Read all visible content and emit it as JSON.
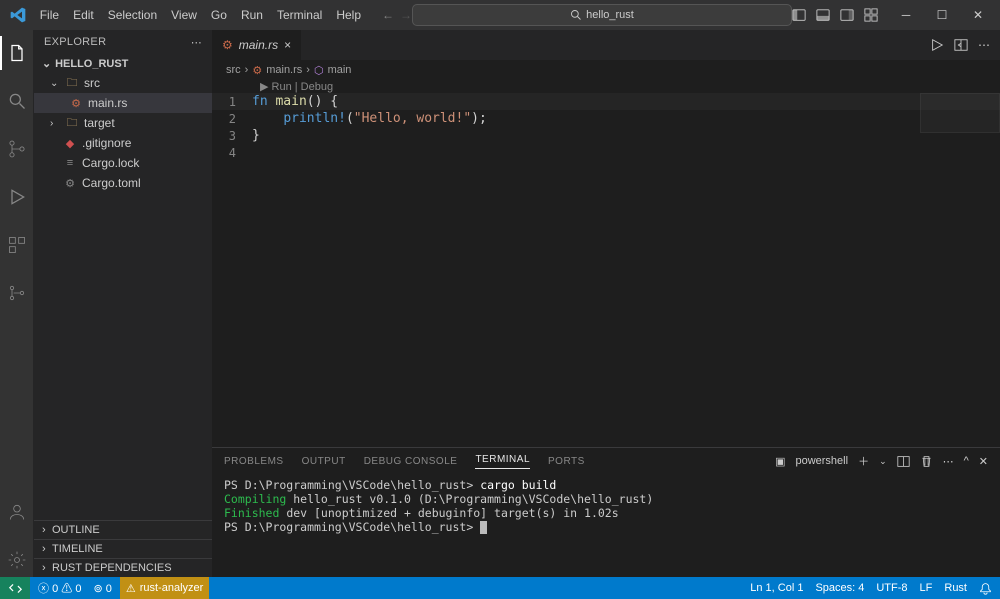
{
  "titlebar": {
    "menu": [
      "File",
      "Edit",
      "Selection",
      "View",
      "Go",
      "Run",
      "Terminal",
      "Help"
    ],
    "search": "hello_rust"
  },
  "sidebar": {
    "title": "EXPLORER",
    "project": "HELLO_RUST",
    "tree": {
      "src": "src",
      "mainrs": "main.rs",
      "target": "target",
      "gitignore": ".gitignore",
      "cargolock": "Cargo.lock",
      "cargotoml": "Cargo.toml"
    },
    "sections": {
      "outline": "OUTLINE",
      "timeline": "TIMELINE",
      "rustdeps": "RUST DEPENDENCIES"
    }
  },
  "tabs": {
    "mainrs": "main.rs"
  },
  "breadcrumb": {
    "src": "src",
    "mainrs": "main.rs",
    "main": "main"
  },
  "codelens": "▶ Run | Debug",
  "code": {
    "l1_kw": "fn ",
    "l1_fn": "main",
    "l1_rest": "() {",
    "l2_macro": "println!",
    "l2_open": "(",
    "l2_str": "\"Hello, world!\"",
    "l2_close": ");",
    "l3": "}"
  },
  "panel": {
    "tabs": {
      "problems": "PROBLEMS",
      "output": "OUTPUT",
      "debug": "DEBUG CONSOLE",
      "terminal": "TERMINAL",
      "ports": "PORTS"
    },
    "shell": "powershell",
    "term": {
      "prompt1": "PS D:\\Programming\\VSCode\\hello_rust> ",
      "cmd1": "cargo build",
      "compiling": "   Compiling",
      "compiling_rest": " hello_rust v0.1.0 (D:\\Programming\\VSCode\\hello_rust)",
      "finished": "    Finished",
      "finished_rest": " dev [unoptimized + debuginfo] target(s) in 1.02s",
      "prompt2": "PS D:\\Programming\\VSCode\\hello_rust> "
    }
  },
  "status": {
    "errors": "0",
    "warnings": "0",
    "radio": "0",
    "analyzer": "rust-analyzer",
    "pos": "Ln 1, Col 1",
    "spaces": "Spaces: 4",
    "encoding": "UTF-8",
    "eol": "LF",
    "lang": "Rust"
  }
}
